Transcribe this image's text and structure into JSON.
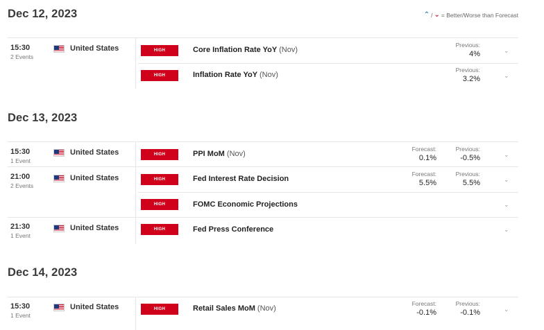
{
  "legend": {
    "text": "= Better/Worse than Forecast"
  },
  "days": [
    {
      "date": "Dec 12, 2023",
      "groups": [
        {
          "time": "15:30",
          "events_count": "2 Events",
          "country": "United States",
          "events": [
            {
              "impact": "HIGH",
              "name": "Core Inflation Rate YoY",
              "period": "(Nov)",
              "forecast_label": "",
              "forecast": "",
              "previous_label": "Previous:",
              "previous": "4%"
            },
            {
              "impact": "HIGH",
              "name": "Inflation Rate YoY",
              "period": "(Nov)",
              "forecast_label": "",
              "forecast": "",
              "previous_label": "Previous:",
              "previous": "3.2%"
            }
          ]
        }
      ]
    },
    {
      "date": "Dec 13, 2023",
      "groups": [
        {
          "time": "15:30",
          "events_count": "1 Event",
          "country": "United States",
          "events": [
            {
              "impact": "HIGH",
              "name": "PPI MoM",
              "period": "(Nov)",
              "forecast_label": "Forecast:",
              "forecast": "0.1%",
              "previous_label": "Previous:",
              "previous": "-0.5%"
            }
          ]
        },
        {
          "time": "21:00",
          "events_count": "2 Events",
          "country": "United States",
          "events": [
            {
              "impact": "HIGH",
              "name": "Fed Interest Rate Decision",
              "period": "",
              "forecast_label": "Forecast:",
              "forecast": "5.5%",
              "previous_label": "Previous:",
              "previous": "5.5%"
            },
            {
              "impact": "HIGH",
              "name": "FOMC Economic Projections",
              "period": "",
              "forecast_label": "",
              "forecast": "",
              "previous_label": "",
              "previous": ""
            }
          ]
        },
        {
          "time": "21:30",
          "events_count": "1 Event",
          "country": "United States",
          "events": [
            {
              "impact": "HIGH",
              "name": "Fed Press Conference",
              "period": "",
              "forecast_label": "",
              "forecast": "",
              "previous_label": "",
              "previous": ""
            }
          ]
        }
      ]
    },
    {
      "date": "Dec 14, 2023",
      "groups": [
        {
          "time": "15:30",
          "events_count": "1 Event",
          "country": "United States",
          "events": [
            {
              "impact": "HIGH",
              "name": "Retail Sales MoM",
              "period": "(Nov)",
              "forecast_label": "Forecast:",
              "forecast": "-0.1%",
              "previous_label": "Previous:",
              "previous": "-0.1%"
            }
          ]
        }
      ]
    }
  ]
}
